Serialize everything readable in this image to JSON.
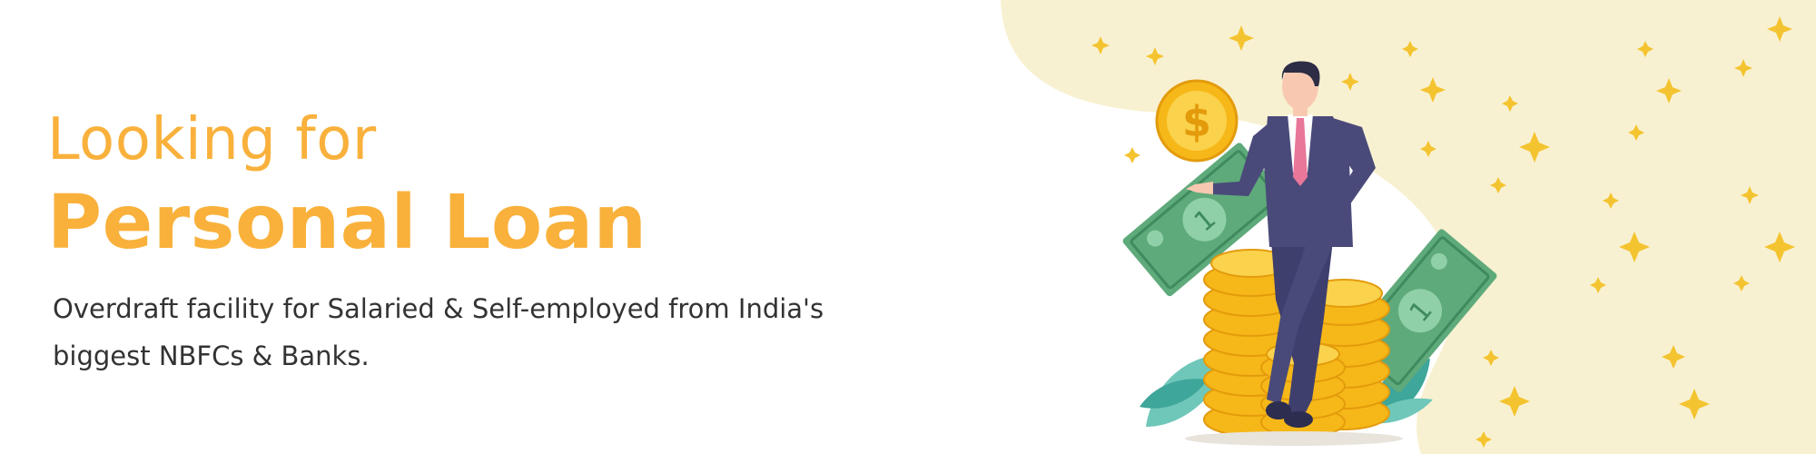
{
  "banner": {
    "headline_small": "Looking for",
    "headline_large": "Personal Loan",
    "subtitle": "Overdraft facility for Salaried & Self-employed from India's biggest NBFCs & Banks."
  },
  "colors": {
    "accent": "#f9b13c",
    "text": "#333333",
    "background_blob": "#f8f1d1",
    "sparkle": "#f4c430",
    "coin": "#f6b818",
    "banknote": "#5faa7b",
    "suit": "#4a4a7a",
    "tie": "#e8779a",
    "leaf": "#3ea69a"
  },
  "icons": {
    "money": "dollar-coin-icon",
    "banknote": "banknote-icon"
  }
}
